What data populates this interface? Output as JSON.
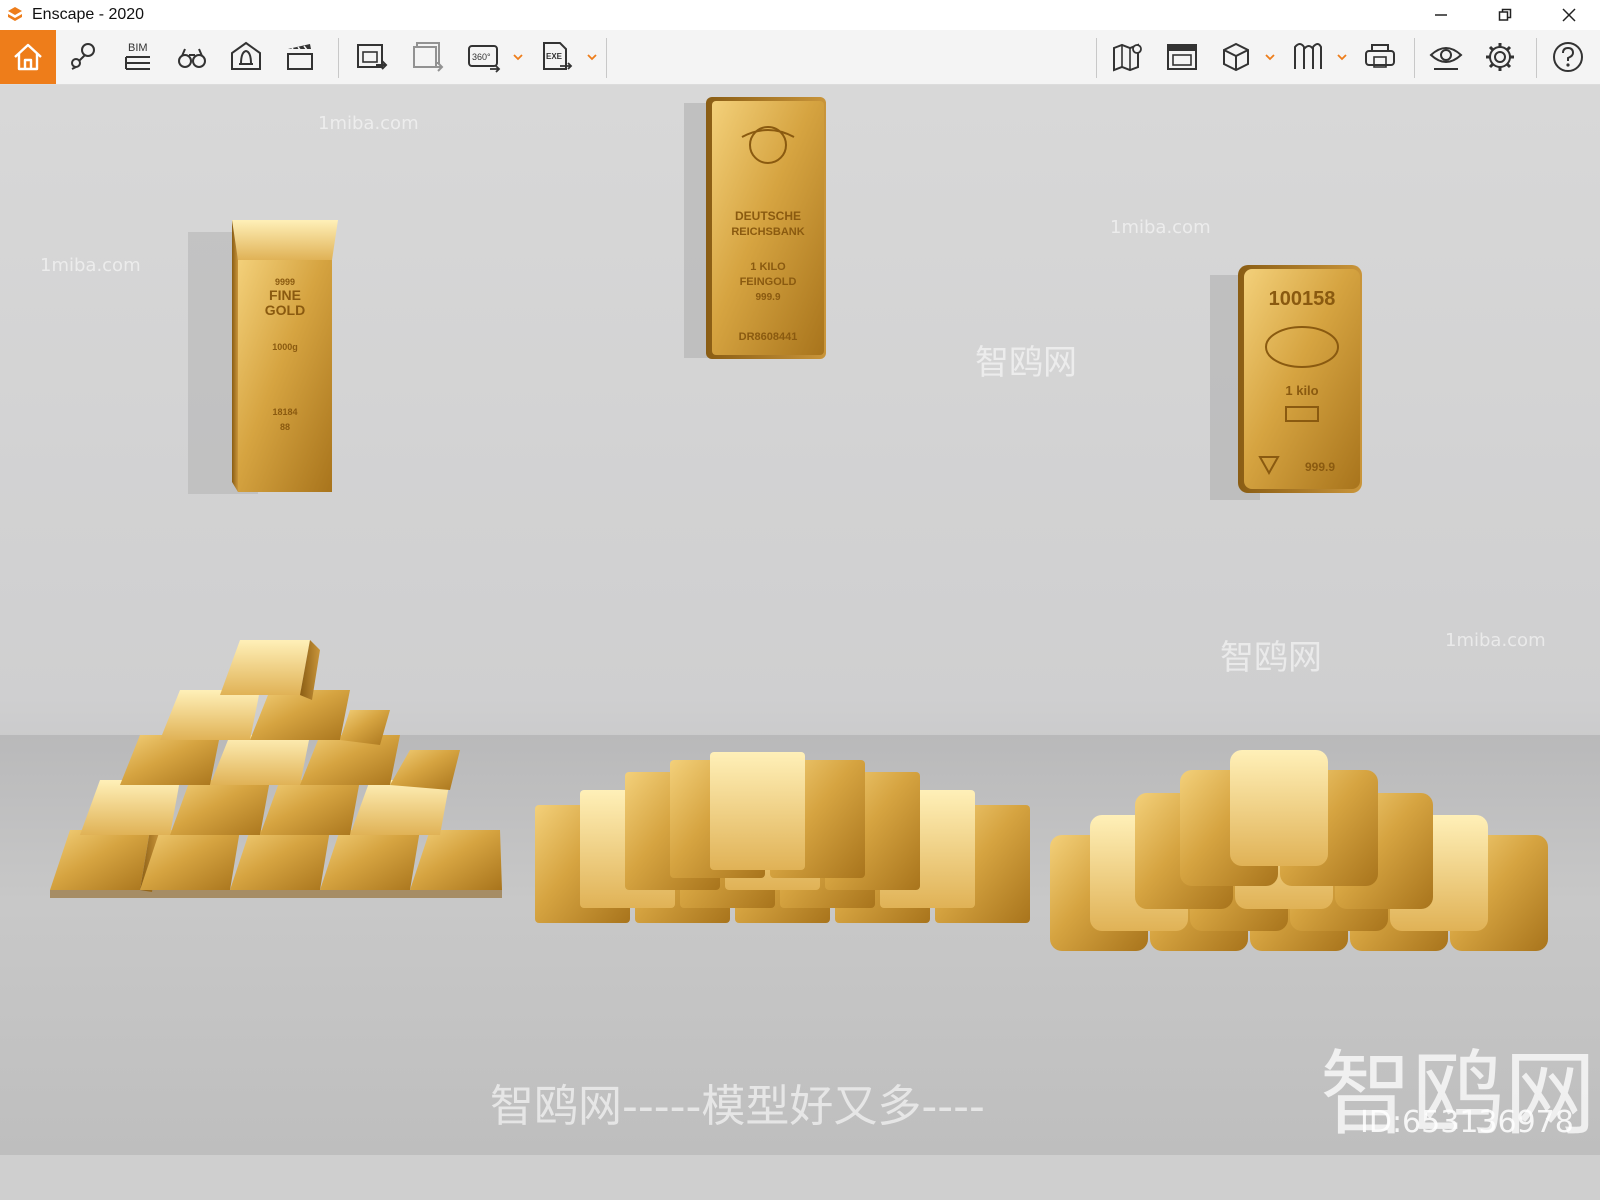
{
  "window": {
    "title": "Enscape - 2020"
  },
  "toolbar": {
    "left_buttons": [
      "home-icon",
      "locator-icon",
      "bim-icon",
      "binoculars-icon",
      "bell-icon",
      "clapper-icon"
    ],
    "bim_label": "BIM",
    "render_buttons": [
      "render-image-icon",
      "batch-render-icon",
      "render-360-icon",
      "export-exe-icon"
    ],
    "badge_360": "360°",
    "badge_exe": "EXE",
    "right_buttons": [
      "map-icon",
      "asset-library-icon",
      "cube-icon",
      "material-icon",
      "vr-headset-icon",
      "visual-settings-icon",
      "settings-icon",
      "help-icon"
    ],
    "accent": "#ee7d1a"
  },
  "scene": {
    "bar_left": {
      "line1": "9999",
      "line2": "FINE",
      "line3": "GOLD",
      "line4": "1000g",
      "line5": "18184",
      "line6": "88"
    },
    "bar_center": {
      "line1": "DEUTSCHE",
      "line2": "REICHSBANK",
      "line3": "1 KILO",
      "line4": "FEINGOLD",
      "line5": "999.9",
      "line6": "DR8608441"
    },
    "bar_right": {
      "line1": "100158",
      "line2": "1 kilo",
      "line3": "999.9"
    }
  },
  "watermarks": {
    "site": "1miba.com",
    "brand": "智鸥网",
    "slogan": "智鸥网-----模型好又多----",
    "big_brand": "智鸥网",
    "id": "ID:653136978"
  }
}
